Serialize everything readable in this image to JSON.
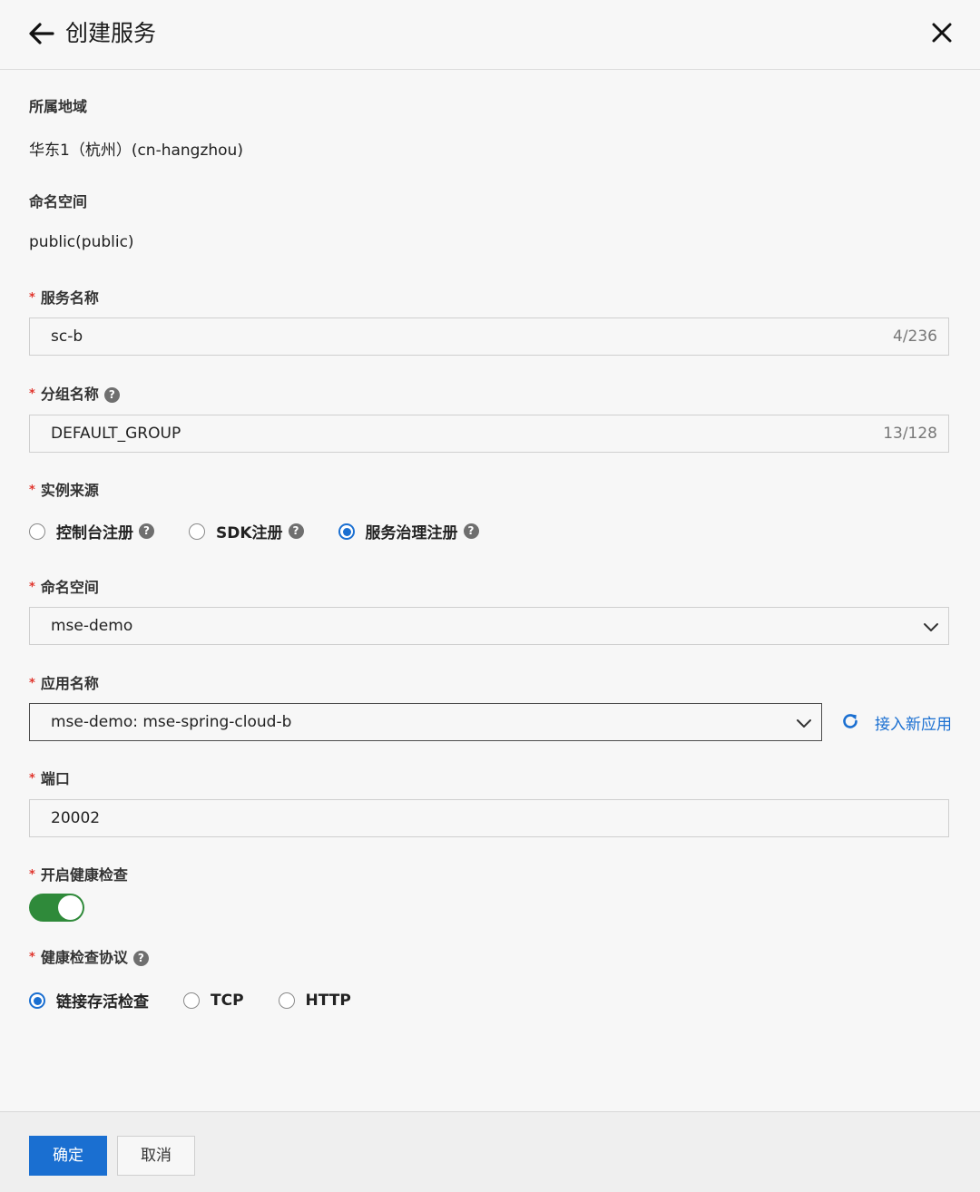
{
  "header": {
    "title": "创建服务"
  },
  "region": {
    "label": "所属地域",
    "value": "华东1（杭州）(cn-hangzhou)"
  },
  "namespace_static": {
    "label": "命名空间",
    "value": "public(public)"
  },
  "service_name": {
    "label": "服务名称",
    "value": "sc-b",
    "counter": "4/236"
  },
  "group_name": {
    "label": "分组名称",
    "value": "DEFAULT_GROUP",
    "counter": "13/128"
  },
  "instance_source": {
    "label": "实例来源",
    "options": [
      {
        "label": "控制台注册",
        "selected": false
      },
      {
        "label": "SDK注册",
        "selected": false
      },
      {
        "label": "服务治理注册",
        "selected": true
      }
    ]
  },
  "namespace_select": {
    "label": "命名空间",
    "value": "mse-demo"
  },
  "app_name": {
    "label": "应用名称",
    "value": "mse-demo: mse-spring-cloud-b",
    "link_label": "接入新应用"
  },
  "port": {
    "label": "端口",
    "value": "20002"
  },
  "health_check": {
    "label": "开启健康检查",
    "enabled": true
  },
  "health_protocol": {
    "label": "健康检查协议",
    "options": [
      {
        "label": "链接存活检查",
        "selected": true
      },
      {
        "label": "TCP",
        "selected": false
      },
      {
        "label": "HTTP",
        "selected": false
      }
    ]
  },
  "footer": {
    "confirm_label": "确定",
    "cancel_label": "取消"
  },
  "colors": {
    "primary": "#1a6fd1",
    "toggle_on": "#2f8a3a",
    "required": "#e0342c"
  }
}
